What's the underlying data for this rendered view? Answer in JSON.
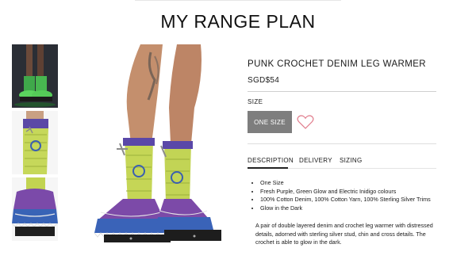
{
  "page": {
    "title": "MY RANGE PLAN"
  },
  "gallery": {
    "thumbnails": [
      "thumbnail-glow",
      "thumbnail-upper-crochet",
      "thumbnail-lower-ruffle"
    ],
    "main_image": "leg-warmers-on-model"
  },
  "product": {
    "name": "PUNK CROCHET DENIM LEG WARMER",
    "price": "SGD$54",
    "size_label": "SIZE",
    "size_option": "ONE SIZE",
    "wishlist_icon": "heart-icon"
  },
  "tabs": [
    {
      "label": "DESCRIPTION",
      "active": true
    },
    {
      "label": "DELIVERY",
      "active": false
    },
    {
      "label": "SIZING",
      "active": false
    }
  ],
  "description": {
    "bullets": [
      "One Size",
      "Fresh Purple, Green Glow and Electric Inidigo colours",
      "100% Cotton Denim, 100% Cotton Yarn, 100% Sterling Silver Trims",
      "Glow in the Dark"
    ],
    "paragraph": "A pair of double layered denim and crochet leg warmer with distressed details, adorned with sterling silver stud, chin and cross details. The crochet is able to glow in the dark."
  },
  "colors": {
    "size_button": "#7e7e7e",
    "heart": "#e07a8a",
    "accent_green": "#b8d84a",
    "accent_purple": "#7c4aa8",
    "accent_blue": "#3a63b8"
  }
}
